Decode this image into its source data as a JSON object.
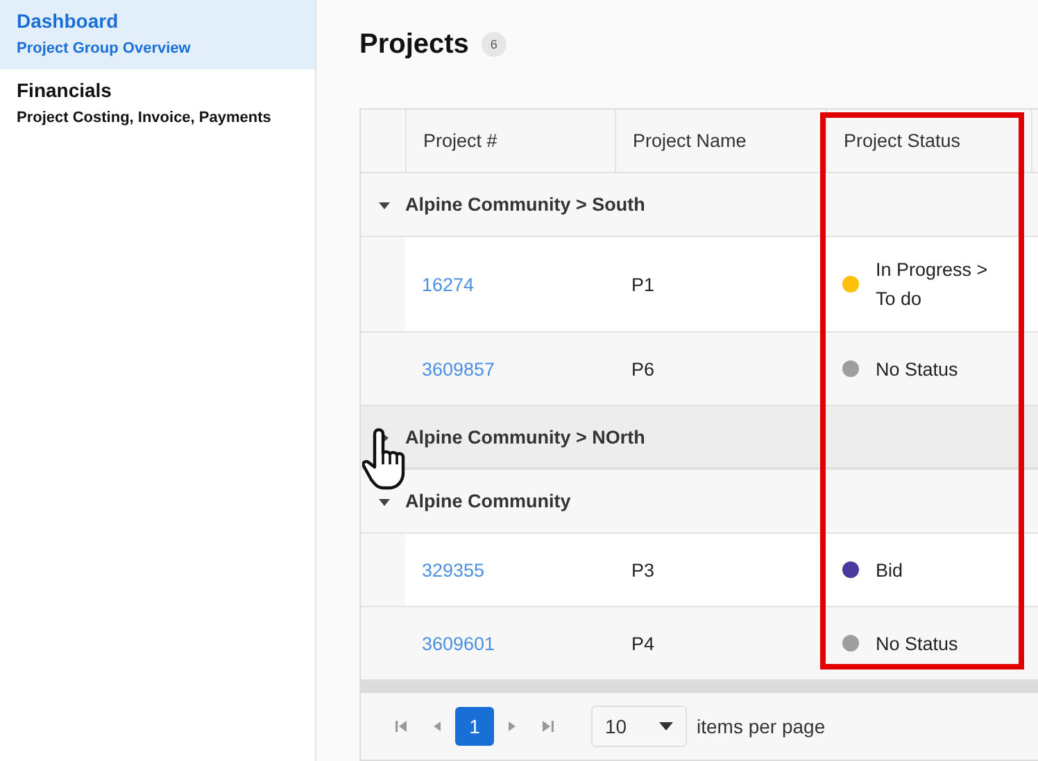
{
  "sidebar": {
    "items": [
      {
        "title": "Dashboard",
        "subtitle": "Project Group Overview",
        "selected": true
      },
      {
        "title": "Financials",
        "subtitle": "Project Costing, Invoice, Payments",
        "selected": false
      }
    ]
  },
  "header": {
    "title": "Projects",
    "count": "6"
  },
  "table": {
    "columns": [
      "Project #",
      "Project Name",
      "Project Status"
    ],
    "groups": [
      {
        "label": "Alpine Community > South",
        "expanded": true,
        "rows": [
          {
            "number": "16274",
            "name": "P1",
            "status": "In Progress > To do",
            "color": "#ffc107"
          },
          {
            "number": "3609857",
            "name": "P6",
            "status": "No Status",
            "color": "#9e9e9e"
          }
        ]
      },
      {
        "label": "Alpine Community > NOrth",
        "expanded": false
      },
      {
        "label": "Alpine Community",
        "expanded": true,
        "rows": [
          {
            "number": "329355",
            "name": "P3",
            "status": "Bid",
            "color": "#4b3a9e"
          },
          {
            "number": "3609601",
            "name": "P4",
            "status": "No Status",
            "color": "#9e9e9e"
          }
        ]
      }
    ]
  },
  "pager": {
    "pages": [
      {
        "label": "1",
        "selected": true
      }
    ],
    "page_size": "10",
    "page_size_label": "items per page"
  }
}
